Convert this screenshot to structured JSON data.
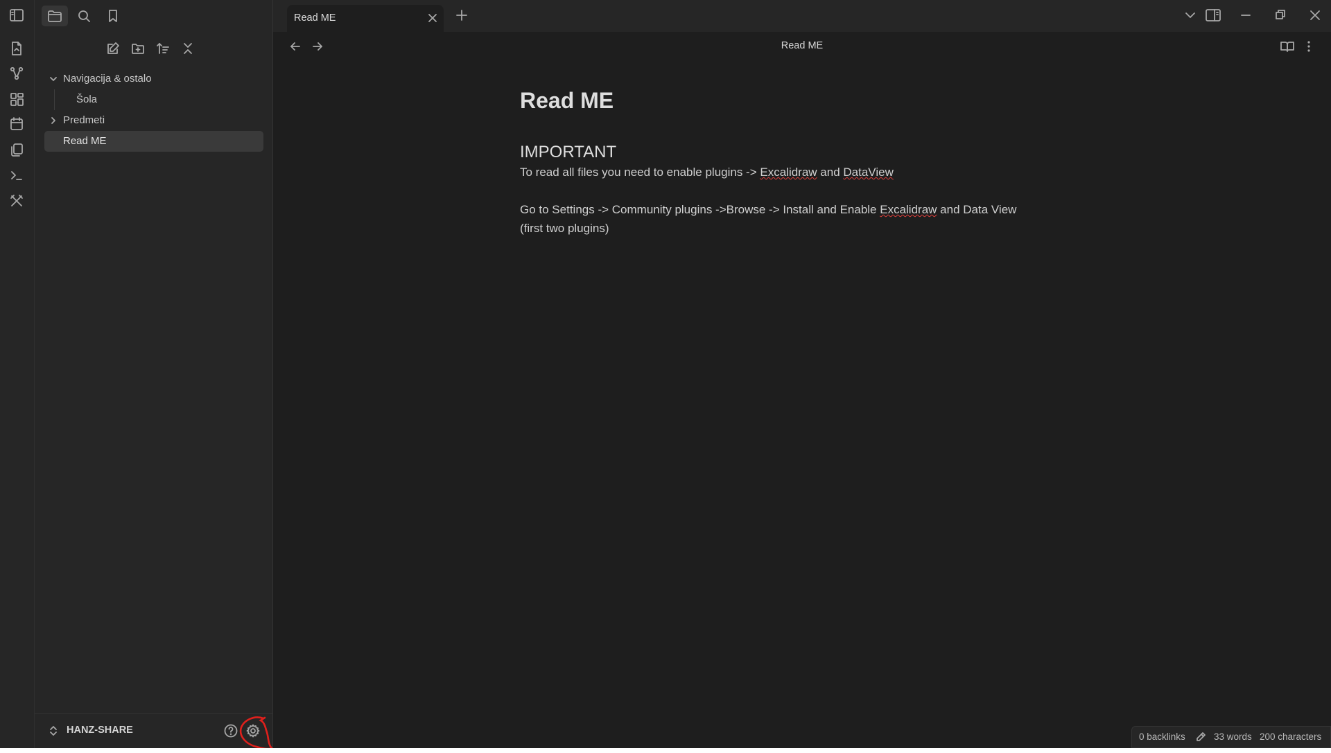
{
  "window": {
    "tabs": [
      {
        "label": "Read ME",
        "active": true
      }
    ]
  },
  "sidebar": {
    "tree": [
      {
        "label": "Navigacija & ostalo",
        "type": "folder",
        "expanded": true
      },
      {
        "label": "Šola",
        "type": "file",
        "level": 1
      },
      {
        "label": "Predmeti",
        "type": "folder",
        "expanded": false
      },
      {
        "label": "Read ME",
        "type": "file",
        "active": true
      }
    ],
    "vault_name": "HANZ-SHARE"
  },
  "view": {
    "title": "Read ME"
  },
  "document": {
    "heading1": "Read ME",
    "heading2": "IMPORTANT",
    "line1_prefix": "To read all files you need to enable plugins -> ",
    "line1_link1": "Excalidraw",
    "line1_and": " and ",
    "line1_link2": "DataView",
    "line2_prefix": "Go to Settings -> Community plugins ->Browse -> Install and Enable ",
    "line2_spell": "Excalidraw",
    "line2_suffix": " and Data View",
    "line3": "(first two plugins)"
  },
  "statusbar": {
    "backlinks": "0 backlinks",
    "words": "33 words",
    "characters": "200 characters"
  },
  "colors": {
    "background": "#1e1e1e",
    "sidebar": "#262626",
    "annotation": "#e0201c"
  }
}
